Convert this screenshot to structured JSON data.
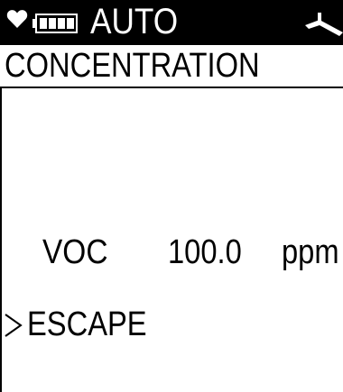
{
  "status_bar": {
    "mode": "AUTO",
    "icons": [
      "heart-icon",
      "battery-icon",
      "signal-icon"
    ],
    "background_color": "#000000",
    "text_color": "#ffffff"
  },
  "screen": {
    "title": "CONCENTRATION"
  },
  "reading": {
    "gas": "VOC",
    "value": "100.0",
    "unit": "ppm"
  },
  "menu": {
    "selected_icon": "selector-arrow-icon",
    "items": [
      {
        "label": "ESCAPE"
      }
    ]
  }
}
